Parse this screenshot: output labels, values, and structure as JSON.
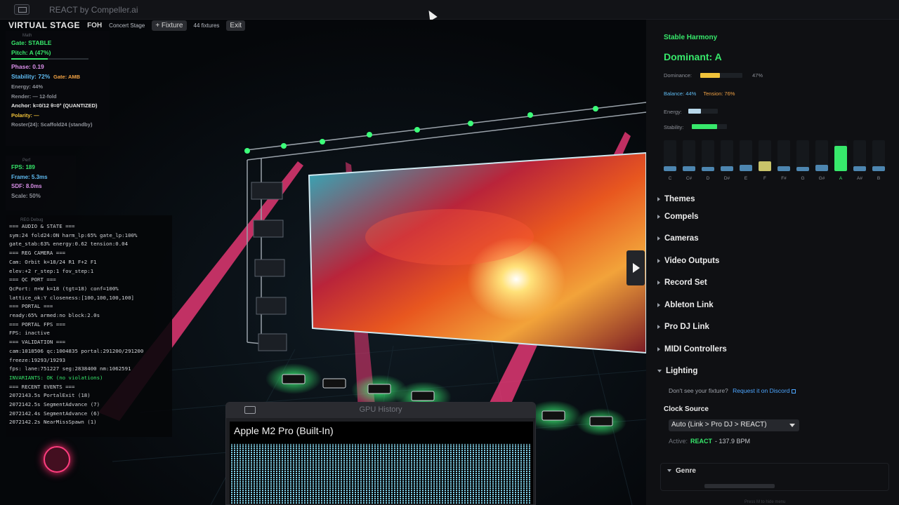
{
  "window": {
    "title": "REACT by Compeller.ai"
  },
  "stage_bar": {
    "title": "VIRTUAL STAGE",
    "view": "FOH",
    "preset": "Concert Stage",
    "add_fixture": "+ Fixture",
    "fixture_count": "44 fixtures",
    "exit": "Exit"
  },
  "math": {
    "header": "Math",
    "gate": "Gate: STABLE",
    "pitch": "Pitch: A (47%)",
    "pitch_fraction": 0.47,
    "phase": "Phase: 0.19",
    "stability": "Stability: 72%",
    "gate_amb": "Gate: AMB",
    "energy": "Energy: 44%",
    "render": "Render: — 12-fold",
    "anchor": "Anchor: k=0/12 θ=0° (QUANTIZED)",
    "polarity": "Polarity: —",
    "roster": "Roster(24): Scaffold24 (standby)"
  },
  "perf": {
    "header": "Perf",
    "fps": "FPS: 189",
    "frame": "Frame: 5.3ms",
    "sdf": "SDF: 8.0ms",
    "scale": "Scale: 50%"
  },
  "debug": {
    "header": "REG Debug",
    "lines": [
      "=== AUDIO & STATE ===",
      "sym:24 fold24:ON harm_lp:65% gate_lp:100%",
      "gate_stab:63% energy:0.62 tension:0.04",
      "=== REG CAMERA ===",
      "Cam: Orbit k=18/24 R1 F+2 F1",
      "elev:+2 r_step:1 fov_step:1",
      "=== QC PORT ===",
      "QcPort: π+W k=18 (tgt=18) conf=100%",
      "lattice_ok:Y closeness:[100,100,100,100]",
      "=== PORTAL ===",
      "ready:65% armed:no block:2.0s",
      "=== PORTAL FPS ===",
      "FPS: inactive",
      "=== VALIDATION ===",
      "cam:1018506 qc:1004835 portal:291200/291200",
      "freeze:19293/19293",
      "fps: lane:751227 seg:2838400 nm:1062591",
      "INVARIANTS: OK (no violations)",
      "=== RECENT EVENTS ===",
      "2072143.5s PortalExit (18)",
      "2072142.5s SegmentAdvance (7)",
      "2072142.4s SegmentAdvance (6)",
      "2072142.2s NearMissSpawn (1)"
    ]
  },
  "gpu_history": {
    "window_title": "GPU History",
    "device": "Apple M2 Pro (Built-In)"
  },
  "harmony": {
    "title": "Stable Harmony",
    "dominant": "Dominant: A",
    "dominance_label": "Dominance:",
    "dominance_value": "47%",
    "dominance_fraction": 0.47,
    "balance": "Balance: 44%",
    "tension": "Tension: 76%",
    "energy_label": "Energy:",
    "energy_fraction": 0.44,
    "stability_label": "Stability:",
    "stability_fraction": 0.72,
    "notes": [
      {
        "label": "C",
        "level": 0.18
      },
      {
        "label": "C#",
        "level": 0.18
      },
      {
        "label": "D",
        "level": 0.16
      },
      {
        "label": "D#",
        "level": 0.18
      },
      {
        "label": "E",
        "level": 0.22
      },
      {
        "label": "F",
        "level": 0.34
      },
      {
        "label": "F#",
        "level": 0.18
      },
      {
        "label": "G",
        "level": 0.16
      },
      {
        "label": "G#",
        "level": 0.22
      },
      {
        "label": "A",
        "level": 0.9
      },
      {
        "label": "A#",
        "level": 0.18
      },
      {
        "label": "B",
        "level": 0.18
      }
    ]
  },
  "sections": [
    {
      "label": "Themes",
      "open": false
    },
    {
      "label": "Compels",
      "open": false
    },
    {
      "label": "Cameras",
      "open": false
    },
    {
      "label": "Video Outputs",
      "open": false
    },
    {
      "label": "Record Set",
      "open": false
    },
    {
      "label": "Ableton Link",
      "open": false
    },
    {
      "label": "Pro DJ Link",
      "open": false
    },
    {
      "label": "MIDI Controllers",
      "open": false
    },
    {
      "label": "Lighting",
      "open": true
    }
  ],
  "lighting": {
    "question": "Don't see your fixture?",
    "request_link": "Request it on Discord",
    "clock_title": "Clock Source",
    "clock_value": "Auto  (Link > Pro DJ > REACT)",
    "active_label": "Active:",
    "active_source": "REACT",
    "active_bpm": "- 137.9 BPM",
    "genre": "Genre"
  },
  "hint": "Press M to hide menu",
  "colors": {
    "accent_green": "#37e86b",
    "dominance_yellow": "#f0c23a",
    "balance_blue": "#5fbbf2",
    "tension_orange": "#f0a144",
    "beam_pink": "#ff3d7f",
    "link_blue": "#4da6ff"
  }
}
